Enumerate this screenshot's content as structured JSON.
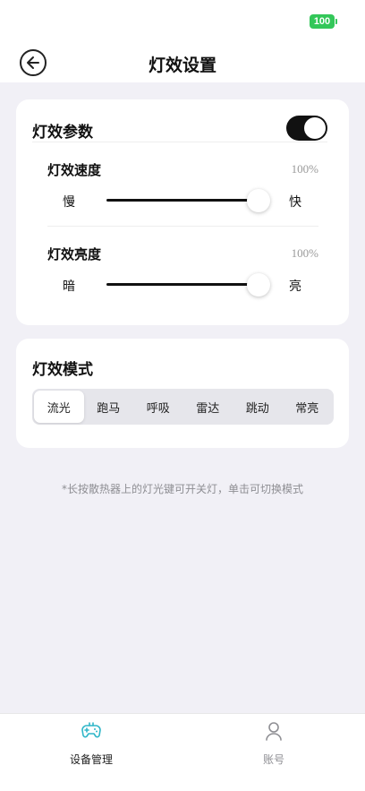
{
  "status_bar": {
    "battery_level": "100",
    "battery_color": "#33c759"
  },
  "nav": {
    "back_icon": "back-arrow-icon",
    "title": "灯效设置"
  },
  "light_params": {
    "title": "灯效参数",
    "enabled": true,
    "speed": {
      "label": "灯效速度",
      "value_text": "100%",
      "value": 100,
      "min_label": "慢",
      "max_label": "快"
    },
    "brightness": {
      "label": "灯效亮度",
      "value_text": "100%",
      "value": 100,
      "min_label": "暗",
      "max_label": "亮"
    }
  },
  "light_mode": {
    "title": "灯效模式",
    "options": [
      "流光",
      "跑马",
      "呼吸",
      "雷达",
      "跳动",
      "常亮"
    ],
    "selected": "流光"
  },
  "hint": "*长按散热器上的灯光键可开关灯，单击可切换模式",
  "tabbar": {
    "items": [
      {
        "label": "设备管理",
        "icon": "gamepad-icon",
        "active": true
      },
      {
        "label": "账号",
        "icon": "user-icon",
        "active": false
      }
    ],
    "active_color": "#2fb6c8"
  }
}
